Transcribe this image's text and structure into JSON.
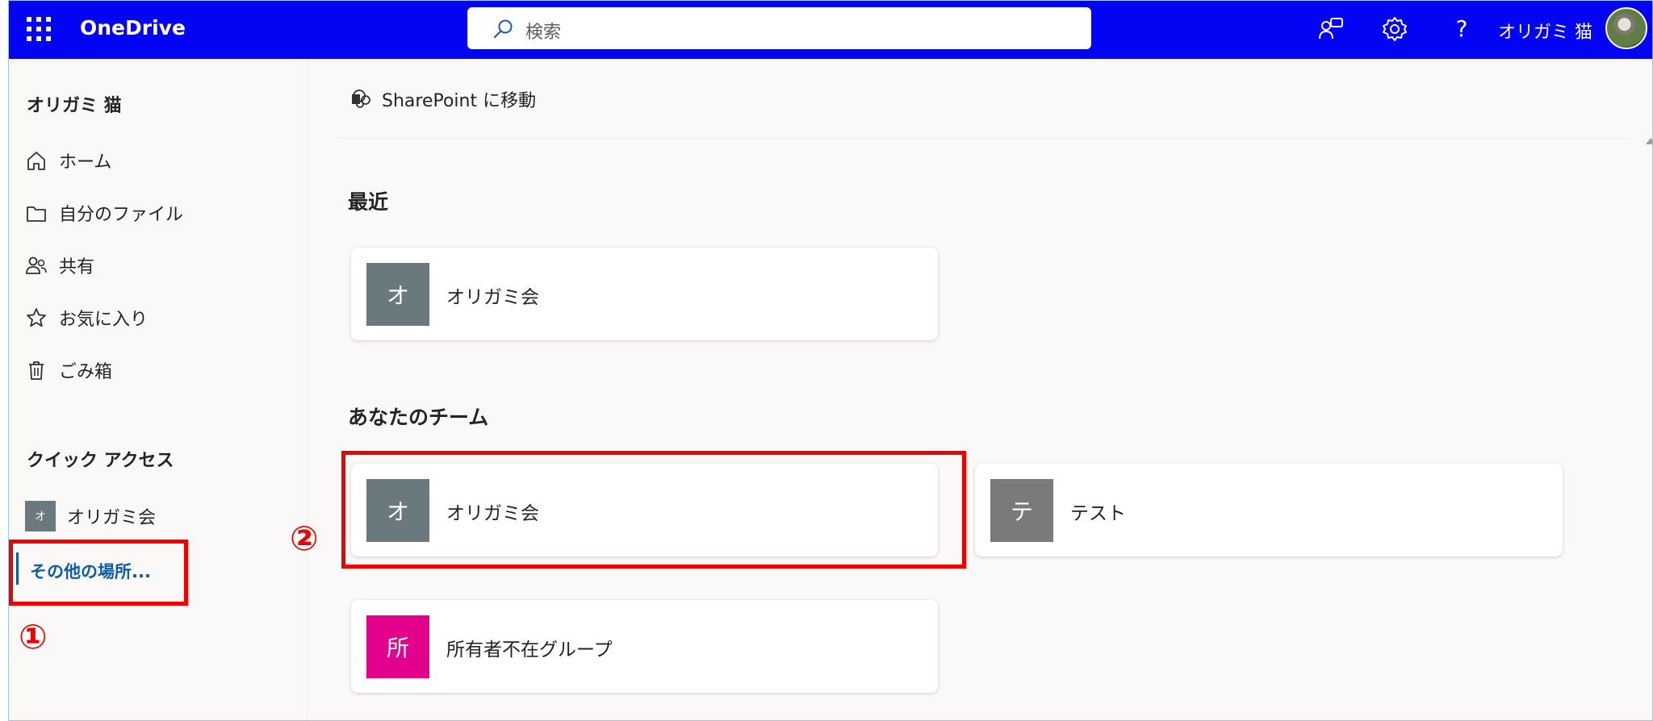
{
  "header": {
    "app_name": "OneDrive",
    "search_placeholder": "検索",
    "user_name": "オリガミ 猫",
    "help_label": "?",
    "background_color": "#0404f4"
  },
  "sidebar": {
    "user_name": "オリガミ 猫",
    "nav": [
      {
        "label": "ホーム",
        "icon": "home-icon"
      },
      {
        "label": "自分のファイル",
        "icon": "folder-icon"
      },
      {
        "label": "共有",
        "icon": "people-icon"
      },
      {
        "label": "お気に入り",
        "icon": "star-icon"
      },
      {
        "label": "ごみ箱",
        "icon": "trash-icon"
      }
    ],
    "quick_access_title": "クイック アクセス",
    "quick_access": [
      {
        "label": "オリガミ会",
        "initial": "オ",
        "color": "#69797e"
      }
    ],
    "more_places": "その他の場所..."
  },
  "main": {
    "sharepoint_link": "SharePoint に移動",
    "recent_title": "最近",
    "recent": [
      {
        "name": "オリガミ会",
        "initial": "オ",
        "color": "#69797e"
      }
    ],
    "teams_title": "あなたのチーム",
    "teams": [
      {
        "name": "オリガミ会",
        "initial": "オ",
        "color": "#69797e"
      },
      {
        "name": "テスト",
        "initial": "テ",
        "color": "#7a7a7a"
      },
      {
        "name": "所有者不在グループ",
        "initial": "所",
        "color": "#e3008c"
      }
    ]
  },
  "annotations": {
    "mark_1": "①",
    "mark_2": "②",
    "highlight_color": "#ee0000"
  }
}
